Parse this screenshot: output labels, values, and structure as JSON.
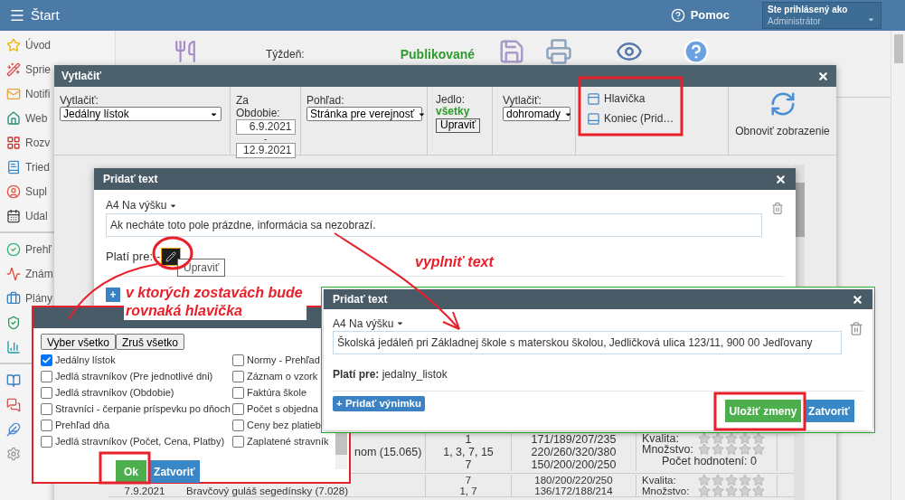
{
  "top_bar": {
    "title": "Štart",
    "help": "Pomoc",
    "user_label": "Ste prihlásený ako",
    "user_value": "Administrátor"
  },
  "sidebar": {
    "groups": [
      {
        "items": [
          {
            "kind": "link",
            "label": "Úvod"
          },
          {
            "kind": "link",
            "label": "Sprie"
          },
          {
            "kind": "link",
            "label": "Notifi"
          },
          {
            "kind": "link",
            "label": "Web"
          },
          {
            "kind": "link",
            "label": "Rozv"
          },
          {
            "kind": "link",
            "label": "Tried"
          },
          {
            "kind": "link",
            "label": "Supl"
          },
          {
            "kind": "link",
            "label": "Udal"
          }
        ]
      },
      {
        "items": [
          {
            "kind": "link",
            "label": "Prehľ"
          },
          {
            "kind": "link",
            "label": "Znám"
          },
          {
            "kind": "link",
            "label": "Plány"
          },
          {
            "kind": "icon"
          },
          {
            "kind": "icon"
          }
        ]
      },
      {
        "items": [
          {
            "kind": "icon"
          },
          {
            "kind": "icon"
          },
          {
            "kind": "icon"
          },
          {
            "kind": "icon"
          }
        ]
      }
    ]
  },
  "toolbar": {
    "week_label": "Týždeň:",
    "status": "Publikované"
  },
  "print_dialog": {
    "title": "Vytlačiť",
    "print_label": "Vytlačiť:",
    "print_value": "Jedálny lístok",
    "period_label": "Za Obdobie:",
    "date_from": "6.9.2021",
    "date_sep": "-",
    "date_to": "12.9.2021",
    "view_label": "Pohľad:",
    "view_value": "Stránka pre verejnosť",
    "meal_label": "Jedlo:",
    "meal_value": "všetky",
    "meal_button": "Upraviť",
    "mode_label": "Vytlačiť:",
    "mode_value": "dohromady",
    "sections": [
      {
        "label": "Hlavička"
      },
      {
        "label": "Koniec (Prid…"
      }
    ],
    "refresh": "Obnoviť zobrazenie",
    "table": {
      "rows": [
        {
          "date": "",
          "name_lines": [
            "nom (15.065)"
          ],
          "counts": [
            "1",
            "1, 3, 7, 15",
            "7"
          ],
          "portions": [
            "171/189/207/235",
            "220/260/320/380",
            "150/200/200/250"
          ],
          "ratings": [
            {
              "label": "Kvalita:",
              "stars": 0
            },
            {
              "label": "Množstvo:",
              "stars": 0
            }
          ],
          "rating_count": "Počet hodnotení: 0"
        },
        {
          "date": "7.9.2021",
          "name_lines": [
            "Bravčový guláš segedínsky (7.028)"
          ],
          "counts": [
            "7",
            "1, 7"
          ],
          "portions": [
            "180/200/220/250",
            "136/172/188/214"
          ],
          "ratings": [
            {
              "label": "Kvalita:",
              "stars": 0
            },
            {
              "label": "Množstvo:",
              "stars": 0
            }
          ]
        }
      ]
    }
  },
  "add_text_dialog": {
    "title": "Pridať text",
    "orientation": "A4 Na výšku",
    "placeholder": "Ak necháte toto pole prázdne, informácia sa nezobrazí.",
    "applies_label": "Platí pre:",
    "applies_value": "-",
    "tooltip": "Upraviť",
    "add_button": "+"
  },
  "reports_dialog": {
    "select_all": "Vyber všetko",
    "clear_all": "Zruš všetko",
    "reports": [
      {
        "label": "Jedálny lístok",
        "checked": true
      },
      {
        "label": "Jedlá stravníkov (Pre jednotlivé dni)",
        "checked": false
      },
      {
        "label": "Jedlá stravníkov (Obdobie)",
        "checked": false
      },
      {
        "label": "Stravníci - čerpanie príspevku po dňoch",
        "checked": false
      },
      {
        "label": "Prehľad dňa",
        "checked": false
      },
      {
        "label": "Jedlá stravníkov (Počet, Cena, Platby)",
        "checked": false
      },
      {
        "label": "Normy - Prehľad",
        "checked": false
      },
      {
        "label": "Záznam o vzork",
        "checked": false
      },
      {
        "label": "Faktúra škole",
        "checked": false
      },
      {
        "label": "Počet s objedna",
        "checked": false
      },
      {
        "label": "Ceny bez platieb",
        "checked": false
      },
      {
        "label": "Zaplatené stravník",
        "checked": false
      }
    ],
    "ok": "Ok",
    "close": "Zatvoriť"
  },
  "filled_dialog": {
    "title": "Pridať text",
    "orientation": "A4 Na výšku",
    "value": "Školská jedáleň pri Základnej škole s materskou školou, Jedličková ulica 123/11, 900 00 Jedľovany",
    "applies_label": "Platí pre:",
    "applies_value": "jedalny_listok",
    "add_exception": "+ Pridať výnimku",
    "save": "Uložiť zmeny",
    "close": "Zatvoriť"
  },
  "annotations": {
    "reports_note": "v ktorých zostavách bude rovnaká hlavička",
    "fill_note": "vyplniť text"
  }
}
